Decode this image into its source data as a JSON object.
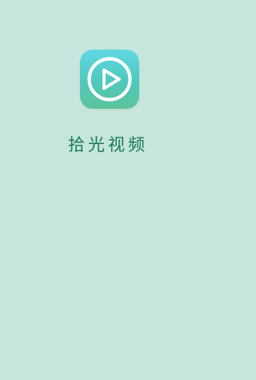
{
  "splash": {
    "app_name": "拾光视频",
    "icon": "play-circle-icon",
    "colors": {
      "background": "#c5e5dd",
      "title": "#1a7a58",
      "icon_gradient_top": "#60d8e4",
      "icon_gradient_bottom": "#5cc49a",
      "icon_glyph": "#ffffff"
    }
  }
}
